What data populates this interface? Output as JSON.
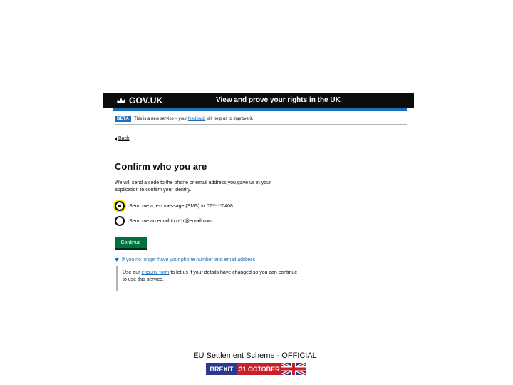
{
  "header": {
    "logo": "GOV.UK",
    "service_name": "View and prove your rights in the UK"
  },
  "phase_banner": {
    "tag": "BETA",
    "text_before": "This is a new service – your",
    "feedback_link": "feedback",
    "text_after": "will help us to improve it."
  },
  "back_link": "Back",
  "page": {
    "title": "Confirm who you are",
    "intro": "We will send a code to the phone or email address you gave us in your application to confirm your identity."
  },
  "options": [
    {
      "label": "Send me a text message (SMS) to 07*****0408",
      "checked": true
    },
    {
      "label": "Send me an email to n**r@email.com",
      "checked": false
    }
  ],
  "continue_label": "Continue",
  "details": {
    "summary": "If you no longer have your phone number and email address",
    "body_before": "Use our",
    "link": "enquiry form",
    "body_after": "to let us if your details have changed so you can continue to use this service."
  },
  "slide_footer": {
    "label": "EU Settlement Scheme - OFFICIAL",
    "banner_word": "BREXIT",
    "banner_date": "31 OCTOBER"
  },
  "colors": {
    "header_black": "#0b0c0c",
    "gov_blue": "#1d70b8",
    "button_green": "#00703c",
    "focus_yellow": "#ffdd00",
    "banner_blue": "#2b3990",
    "banner_red": "#c8202b"
  }
}
